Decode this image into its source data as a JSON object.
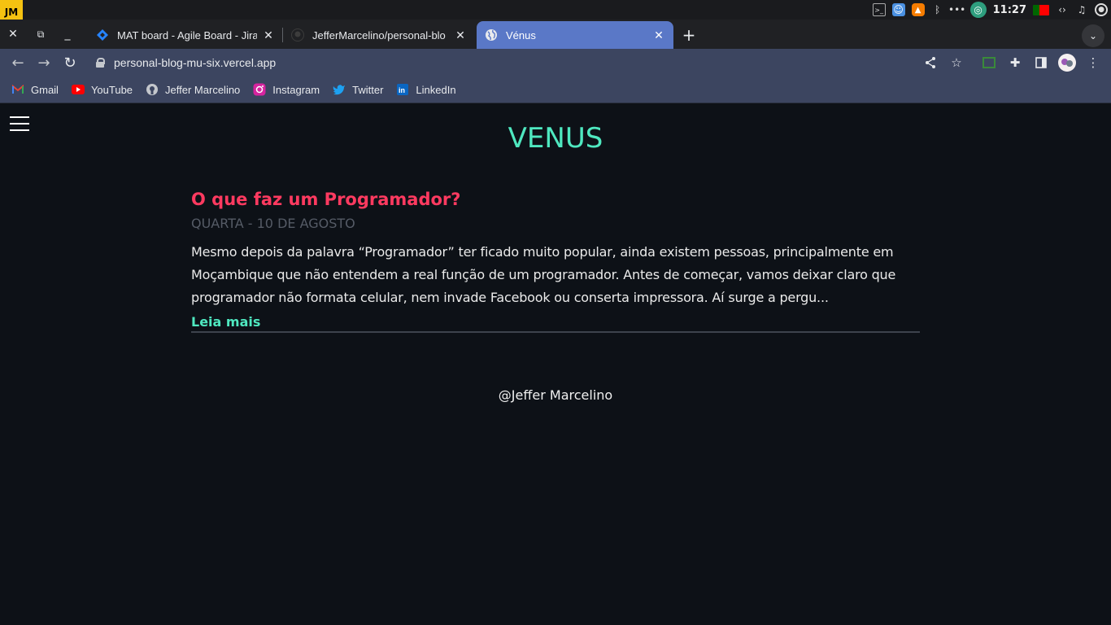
{
  "system": {
    "logo": "JM",
    "time": "11:27"
  },
  "tabs": [
    {
      "title": "MAT board - Agile Board - Jira",
      "icon": "jira-icon"
    },
    {
      "title": "JefferMarcelino/personal-blo",
      "icon": "github-icon"
    },
    {
      "title": "Vénus",
      "icon": "globe-icon",
      "active": true
    }
  ],
  "address": {
    "url": "personal-blog-mu-six.vercel.app"
  },
  "bookmarks": [
    {
      "label": "Gmail",
      "icon": "gmail-icon",
      "color": "#ea4335"
    },
    {
      "label": "YouTube",
      "icon": "youtube-icon",
      "color": "#ff0000"
    },
    {
      "label": "Jeffer Marcelino",
      "icon": "github-icon",
      "color": "#c4c7cc"
    },
    {
      "label": "Instagram",
      "icon": "instagram-icon",
      "color": "#e1306c"
    },
    {
      "label": "Twitter",
      "icon": "twitter-icon",
      "color": "#1da1f2"
    },
    {
      "label": "LinkedIn",
      "icon": "linkedin-icon",
      "color": "#0a66c2"
    }
  ],
  "page": {
    "site_title": "VENUS",
    "post": {
      "title": "O que faz um Programador?",
      "date": "QUARTA - 10 DE AGOSTO",
      "excerpt": "Mesmo depois da palavra “Programador” ter ficado muito popular, ainda existem pessoas, principalmente em Moçambique que não entendem a real função de um programador. Antes de começar, vamos deixar claro que programador não formata celular, nem invade Facebook ou conserta impressora. Aí surge a pergu...",
      "read_more": "Leia mais"
    },
    "footer": "@Jeffer Marcelino"
  },
  "colors": {
    "accent_teal": "#4fe8c0",
    "post_title_red": "#ff3a60",
    "active_tab": "#5a78c7",
    "page_bg": "#0d1117"
  }
}
